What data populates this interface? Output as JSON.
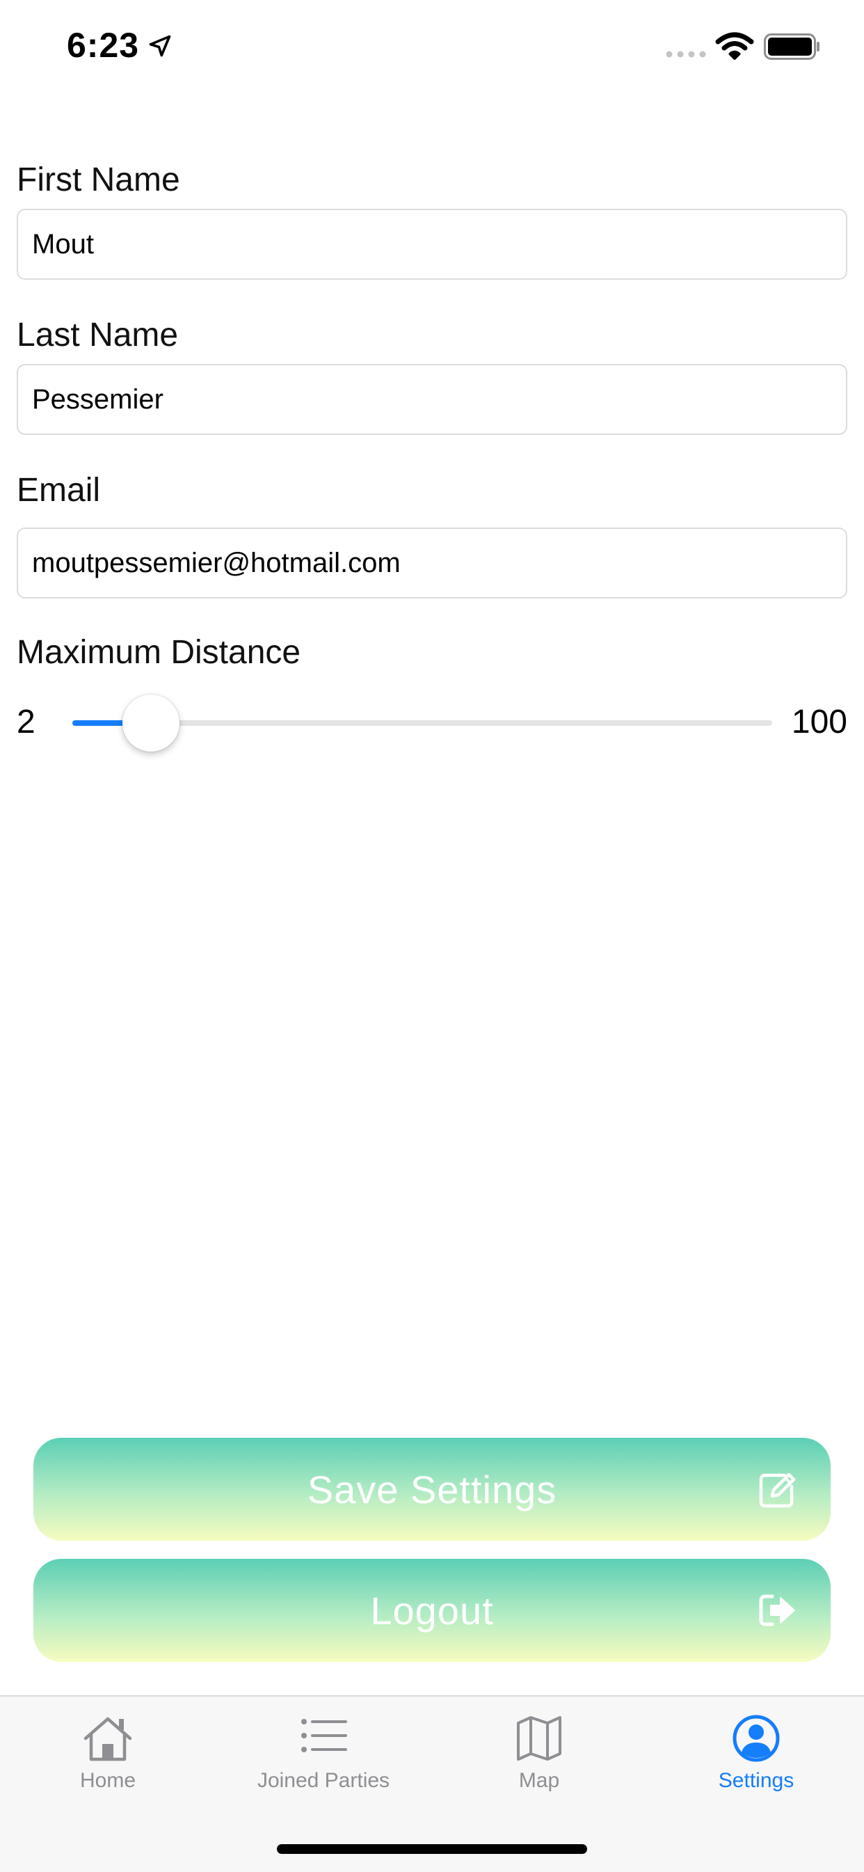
{
  "status_bar": {
    "time": "6:23"
  },
  "form": {
    "first_name": {
      "label": "First Name",
      "value": "Mout"
    },
    "last_name": {
      "label": "Last Name",
      "value": "Pessemier"
    },
    "email": {
      "label": "Email",
      "value": "moutpessemier@hotmail.com"
    },
    "max_distance": {
      "label": "Maximum Distance",
      "min_label": "2",
      "max_label": "100",
      "min": 2,
      "max": 100,
      "value": 13
    }
  },
  "buttons": {
    "save": {
      "label": "Save Settings",
      "icon": "edit-icon"
    },
    "logout": {
      "label": "Logout",
      "icon": "sign-out-icon"
    }
  },
  "tabs": [
    {
      "label": "Home",
      "icon": "home-icon",
      "active": false
    },
    {
      "label": "Joined Parties",
      "icon": "list-icon",
      "active": false
    },
    {
      "label": "Map",
      "icon": "map-icon",
      "active": false
    },
    {
      "label": "Settings",
      "icon": "user-circle-icon",
      "active": true
    }
  ],
  "colors": {
    "accent": "#147efb",
    "inactive": "#8e8e93",
    "button_gradient_top": "#5ccfb5",
    "button_gradient_bottom": "#f6fcc0"
  }
}
